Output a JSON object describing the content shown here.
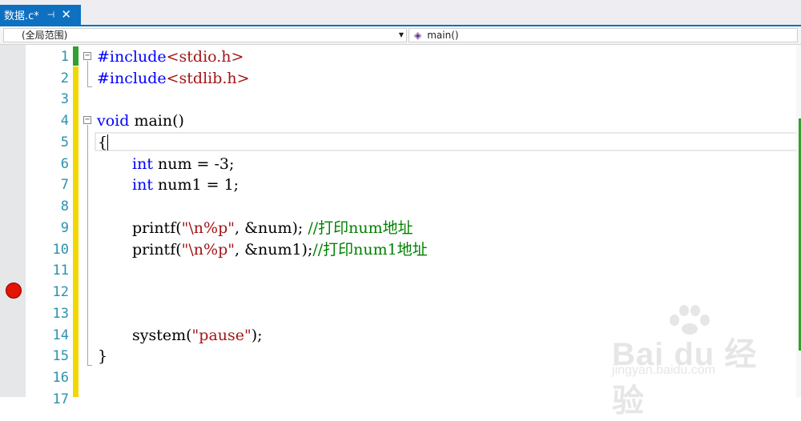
{
  "tab": {
    "title": "数据.c*",
    "pin_icon": "pin-icon",
    "close_icon": "close-icon"
  },
  "nav": {
    "scope": "(全局范围)",
    "function": "main()",
    "function_icon": "method-cube-icon"
  },
  "lines": [
    {
      "n": "1"
    },
    {
      "n": "2"
    },
    {
      "n": "3"
    },
    {
      "n": "4"
    },
    {
      "n": "5"
    },
    {
      "n": "6"
    },
    {
      "n": "7"
    },
    {
      "n": "8"
    },
    {
      "n": "9"
    },
    {
      "n": "10"
    },
    {
      "n": "11"
    },
    {
      "n": "12"
    },
    {
      "n": "13"
    },
    {
      "n": "14"
    },
    {
      "n": "15"
    },
    {
      "n": "16"
    },
    {
      "n": "17"
    }
  ],
  "code": {
    "l1_kw": "#include",
    "l1_str": "<stdio.h>",
    "l2_kw": "#include",
    "l2_str": "<stdlib.h>",
    "l4_kw": "void",
    "l4_rest": " main()",
    "l5": "{",
    "l6_kw": "int",
    "l6_rest": " num = -3;",
    "l7_kw": "int",
    "l7_rest": " num1 = 1;",
    "l9_a": "printf(",
    "l9_str": "\"\\n%p\"",
    "l9_b": ", &num); ",
    "l9_cm": "//打印num地址",
    "l10_a": "printf(",
    "l10_str": "\"\\n%p\"",
    "l10_b": ", &num1);",
    "l10_cm": "//打印num1地址",
    "l14_a": "system(",
    "l14_str": "\"pause\"",
    "l14_b": ");",
    "l15": "}"
  },
  "watermark": {
    "brand": "Bai du 经验",
    "url": "jingyan.baidu.com"
  },
  "colors": {
    "keyword": "#0000ff",
    "string": "#a31515",
    "comment": "#008000",
    "line_number": "#2b91af",
    "tab_active": "#0e70c0",
    "breakpoint": "#e51400"
  },
  "breakpoint_line": 12
}
